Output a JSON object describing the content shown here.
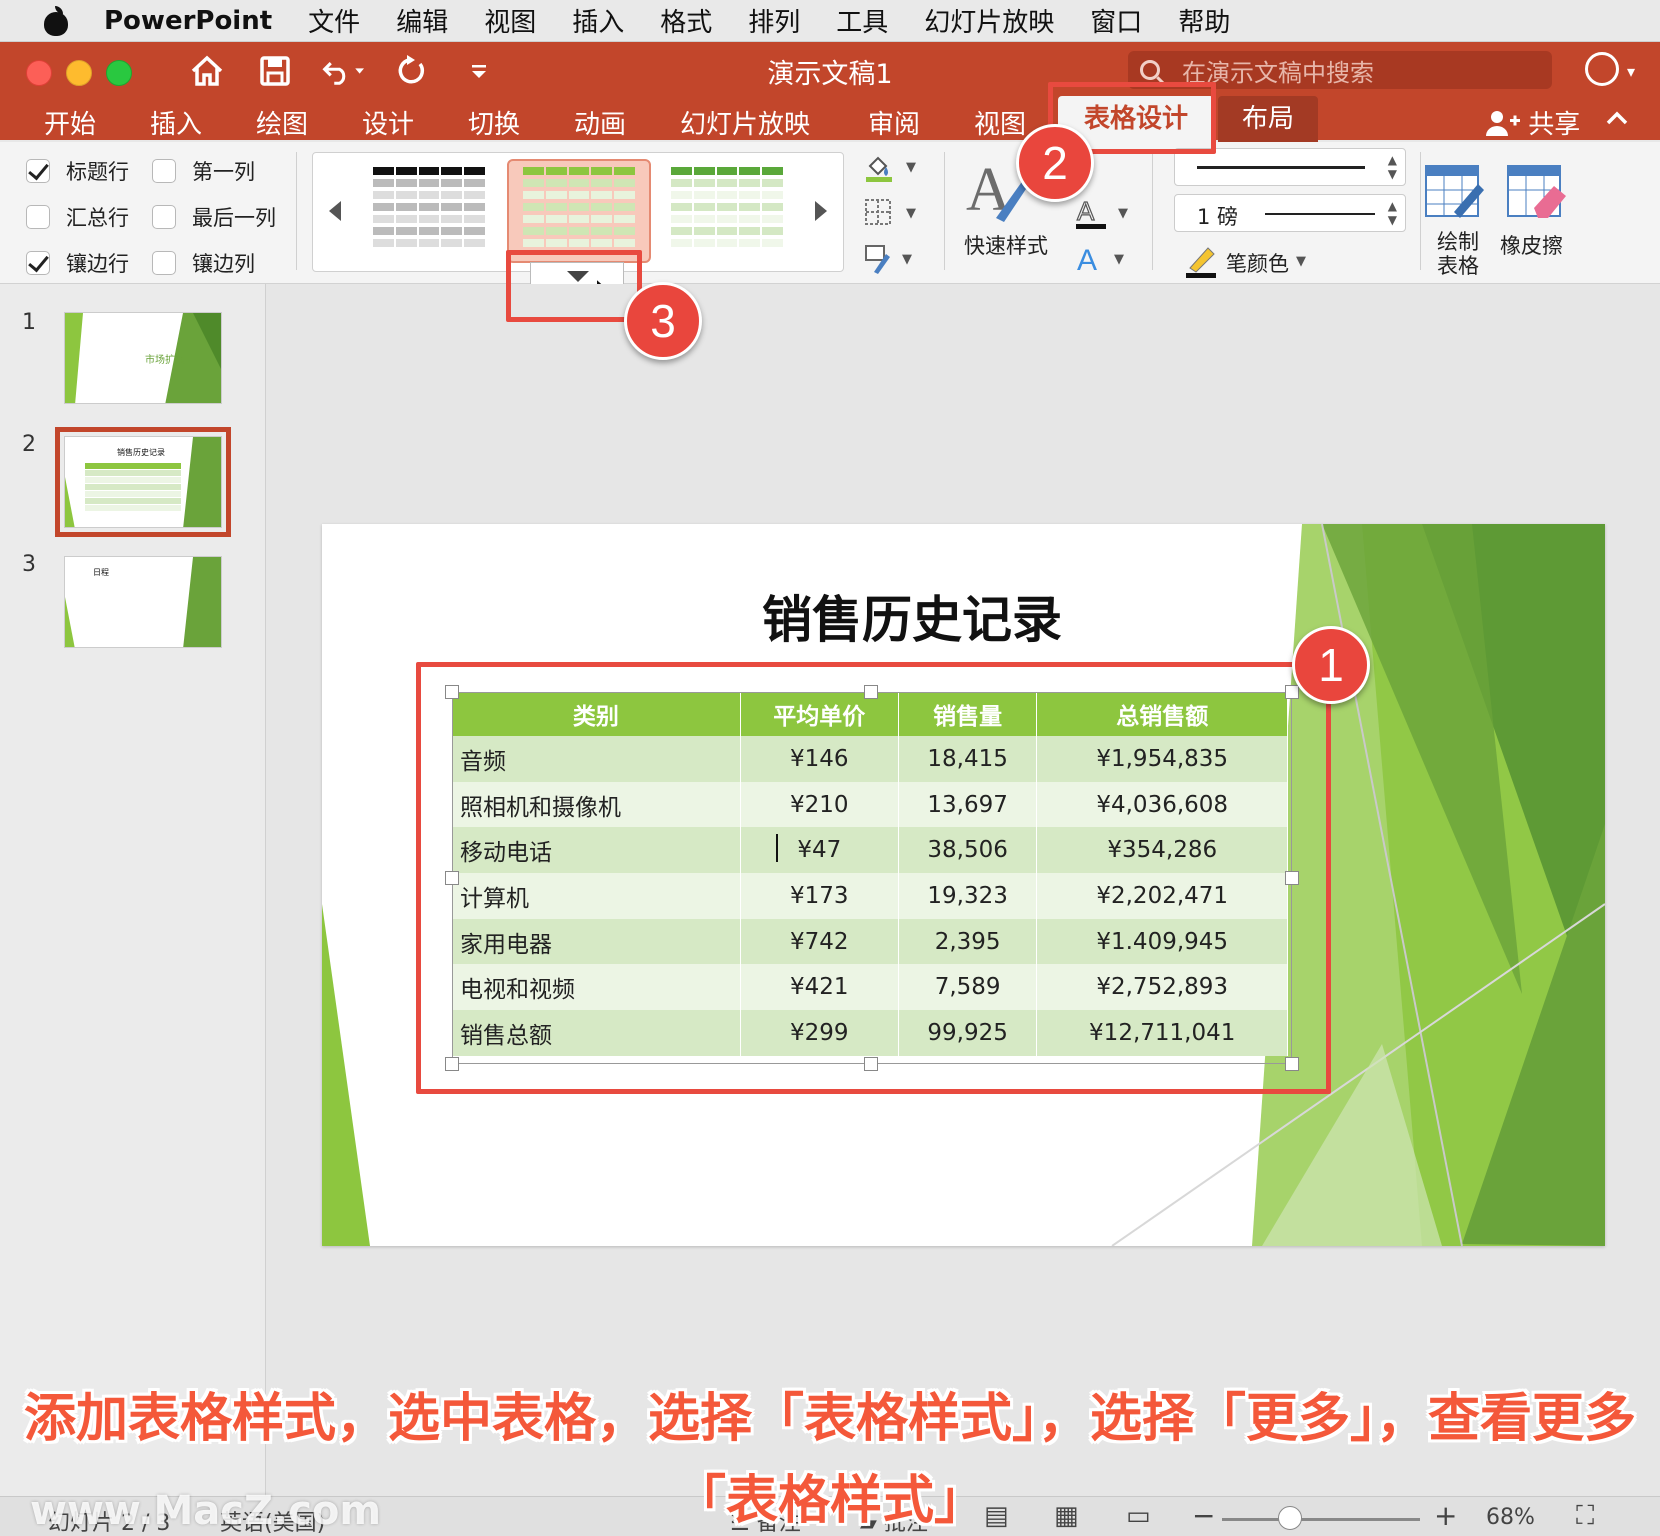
{
  "menubar": {
    "app": "PowerPoint",
    "items": [
      "文件",
      "编辑",
      "视图",
      "插入",
      "格式",
      "排列",
      "工具",
      "幻灯片放映",
      "窗口",
      "帮助"
    ]
  },
  "titlebar": {
    "doc_title": "演示文稿1",
    "search_placeholder": "在演示文稿中搜索"
  },
  "tabs": {
    "start": "开始",
    "insert": "插入",
    "draw": "绘图",
    "design": "设计",
    "transitions": "切换",
    "animations": "动画",
    "slideshow": "幻灯片放映",
    "review": "审阅",
    "view": "视图",
    "table_design": "表格设计",
    "layout": "布局",
    "share": "共享"
  },
  "ribbon": {
    "options": {
      "header_row": "标题行",
      "first_col": "第一列",
      "total_row": "汇总行",
      "last_col": "最后一列",
      "banded_rows": "镶边行",
      "banded_cols": "镶边列"
    },
    "quick_styles": "快速样式",
    "line_weight": "1 磅",
    "pen_color": "笔颜色",
    "draw_table": "绘制表格",
    "eraser": "橡皮擦"
  },
  "colors": {
    "accent": "#c2462b",
    "table_header": "#8dc63f",
    "callout": "#e84a3f",
    "caption": "#f4583a"
  },
  "slides": {
    "numbers": [
      "1",
      "2",
      "3"
    ],
    "thumb1_title": "市场扩展",
    "thumb2_title": "销售历史记录",
    "thumb3_title": "日程"
  },
  "slide": {
    "title": "销售历史记录",
    "table": {
      "headers": [
        "类别",
        "平均单价",
        "销售量",
        "总销售额"
      ],
      "rows": [
        [
          "音频",
          "¥146",
          "18,415",
          "¥1,954,835"
        ],
        [
          "照相机和摄像机",
          "¥210",
          "13,697",
          "¥4,036,608"
        ],
        [
          "移动电话",
          "¥47",
          "38,506",
          "¥354,286"
        ],
        [
          "计算机",
          "¥173",
          "19,323",
          "¥2,202,471"
        ],
        [
          "家用电器",
          "¥742",
          "2,395",
          "¥1.409,945"
        ],
        [
          "电视和视频",
          "¥421",
          "7,589",
          "¥2,752,893"
        ],
        [
          "销售总额",
          "¥299",
          "99,925",
          "¥12,711,041"
        ]
      ]
    }
  },
  "callouts": [
    "1",
    "2",
    "3"
  ],
  "caption": {
    "line1": "添加表格样式，选中表格，选择「表格样式」，选择「更多」，查看更多",
    "line2": "「表格样式」"
  },
  "status": {
    "slide_info": "幻灯片 2 / 3",
    "language": "英语(美国)",
    "notes": "备注",
    "comments": "批注",
    "zoom": "68%"
  },
  "watermark": "www.MacZ.com"
}
